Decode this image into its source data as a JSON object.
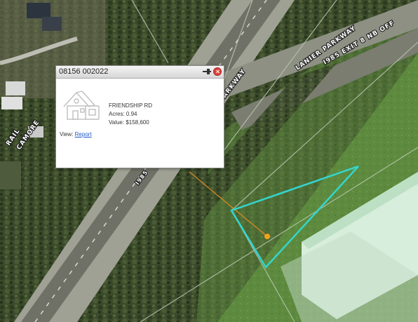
{
  "map": {
    "road_labels": {
      "lanier_parkway": "LANIER PARKWAY",
      "i985_exit": "I985 EXIT 8 NB OFF",
      "parkway_partial": "ARKWAY",
      "i985_partial": "I985",
      "sycamore_partial": "CAMORE",
      "rail_partial": "RAIL"
    },
    "colors": {
      "parcel_outline": "#33d6cf",
      "leader_line": "#e08a1f",
      "parcel_marker": "#f2a21a"
    }
  },
  "popup": {
    "title": "08156 002022",
    "pin_icon": "pin-icon",
    "close_icon": "close-icon",
    "house_icon": "house-icon",
    "road": "FRIENDSHIP RD",
    "acres": "Acres: 0.94",
    "value": "Value: $158,600",
    "view_label": "View:",
    "report_link": "Report"
  }
}
